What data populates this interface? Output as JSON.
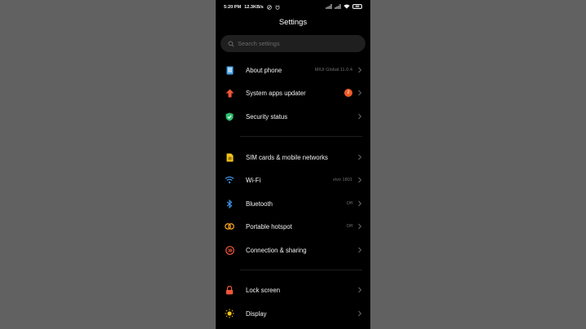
{
  "status_bar": {
    "time": "5:20 PM",
    "speed": "12.3KB/s",
    "battery": "58"
  },
  "header": {
    "title": "Settings"
  },
  "search": {
    "placeholder": "Search settings"
  },
  "colors": {
    "background_outer": "#616161",
    "screen": "#000000",
    "badge": "#ef5a24"
  },
  "groups": [
    {
      "items": [
        {
          "label": "About phone",
          "value": "MIUI Global 11.0.4",
          "icon": "phone-info-icon"
        },
        {
          "label": "System apps updater",
          "badge": "2",
          "icon": "arrow-up-icon"
        },
        {
          "label": "Security status",
          "icon": "shield-check-icon"
        }
      ]
    },
    {
      "items": [
        {
          "label": "SIM cards & mobile networks",
          "icon": "sim-card-icon"
        },
        {
          "label": "Wi-Fi",
          "value": "vivo 1801",
          "icon": "wifi-icon"
        },
        {
          "label": "Bluetooth",
          "value": "Off",
          "icon": "bluetooth-icon"
        },
        {
          "label": "Portable hotspot",
          "value": "Off",
          "icon": "hotspot-icon"
        },
        {
          "label": "Connection & sharing",
          "icon": "connection-sharing-icon"
        }
      ]
    },
    {
      "items": [
        {
          "label": "Lock screen",
          "icon": "lock-icon"
        },
        {
          "label": "Display",
          "icon": "sun-icon"
        }
      ]
    }
  ]
}
